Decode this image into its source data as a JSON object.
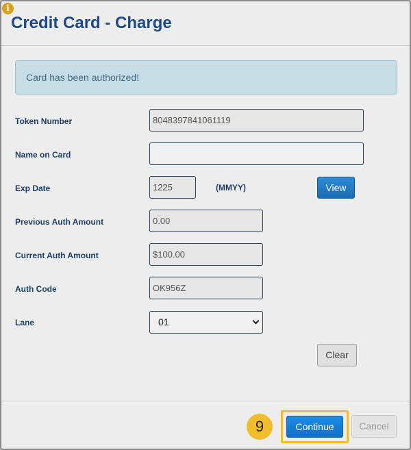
{
  "dialog": {
    "title": "Credit Card - Charge",
    "info_icon": "i",
    "alert": "Card has been authorized!"
  },
  "form": {
    "token_number": {
      "label": "Token Number",
      "value": "8048397841061119"
    },
    "name_on_card": {
      "label": "Name on Card",
      "value": ""
    },
    "exp_date": {
      "label": "Exp Date",
      "value": "1225",
      "hint": "(MMYY)"
    },
    "previous_auth_amount": {
      "label": "Previous Auth Amount",
      "value": "0.00"
    },
    "current_auth_amount": {
      "label": "Current Auth Amount",
      "value": "$100.00"
    },
    "auth_code": {
      "label": "Auth Code",
      "value": "OK956Z"
    },
    "lane": {
      "label": "Lane",
      "value": "01"
    }
  },
  "buttons": {
    "view": "View",
    "clear": "Clear",
    "continue": "Continue",
    "cancel": "Cancel"
  },
  "annotation": {
    "step": "9"
  },
  "colors": {
    "title": "#1c4a86",
    "primary": "#1f8ee6",
    "highlight": "#f0be2b",
    "alert_bg": "#c7dde6"
  }
}
